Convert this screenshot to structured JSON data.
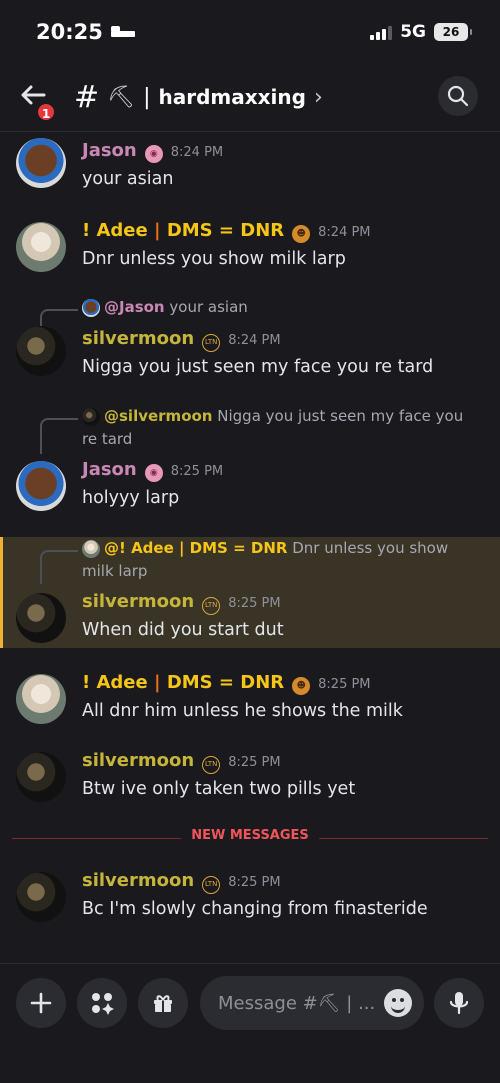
{
  "status": {
    "time": "20:25",
    "network": "5G",
    "battery": "26"
  },
  "header": {
    "notifications": "1",
    "hash": "#",
    "channel_emoji": "⛏",
    "divider": "|",
    "channel_name": "hardmaxxing",
    "chevron": "›"
  },
  "messages": [
    {
      "author": "Jason",
      "badge": "brain",
      "time": "8:24 PM",
      "text": "your asian"
    },
    {
      "author_parts": [
        "! Adee",
        " | ",
        "DMS = DNR"
      ],
      "badge": "emoji",
      "time": "8:24 PM",
      "text": "Dnr unless you show milk larp"
    },
    {
      "reply_to": "@Jason",
      "reply_text": "your asian",
      "author": "silvermoon",
      "badge": "LTN",
      "time": "8:24 PM",
      "text": "Nigga you just seen my face you re tard"
    },
    {
      "reply_to": "@silvermoon",
      "reply_text": "Nigga you just seen my face you re tard",
      "author": "Jason",
      "badge": "brain",
      "time": "8:25 PM",
      "text": "holyyy larp"
    },
    {
      "reply_to": "@! Adee | DMS = DNR",
      "reply_text": "Dnr unless you show milk larp",
      "author": "silvermoon",
      "badge": "LTN",
      "time": "8:25 PM",
      "text": "When did you start dut"
    },
    {
      "author_parts": [
        "! Adee",
        " | ",
        "DMS = DNR"
      ],
      "badge": "emoji",
      "time": "8:25 PM",
      "text": "All dnr him unless he shows the milk"
    },
    {
      "author": "silvermoon",
      "badge": "LTN",
      "time": "8:25 PM",
      "text": "Btw ive only taken two pills yet"
    },
    {
      "author": "silvermoon",
      "badge": "LTN",
      "time": "8:25 PM",
      "text": "Bc I'm slowly changing from finasteride"
    }
  ],
  "divider": {
    "label": "NEW MESSAGES"
  },
  "composer": {
    "placeholder": "Message #⛏ | ..."
  },
  "colors": {
    "accent_mention": "#f0b232",
    "new_messages": "#f2545b",
    "silvermoon": "#c5b53a",
    "jason": "#c987b5"
  }
}
